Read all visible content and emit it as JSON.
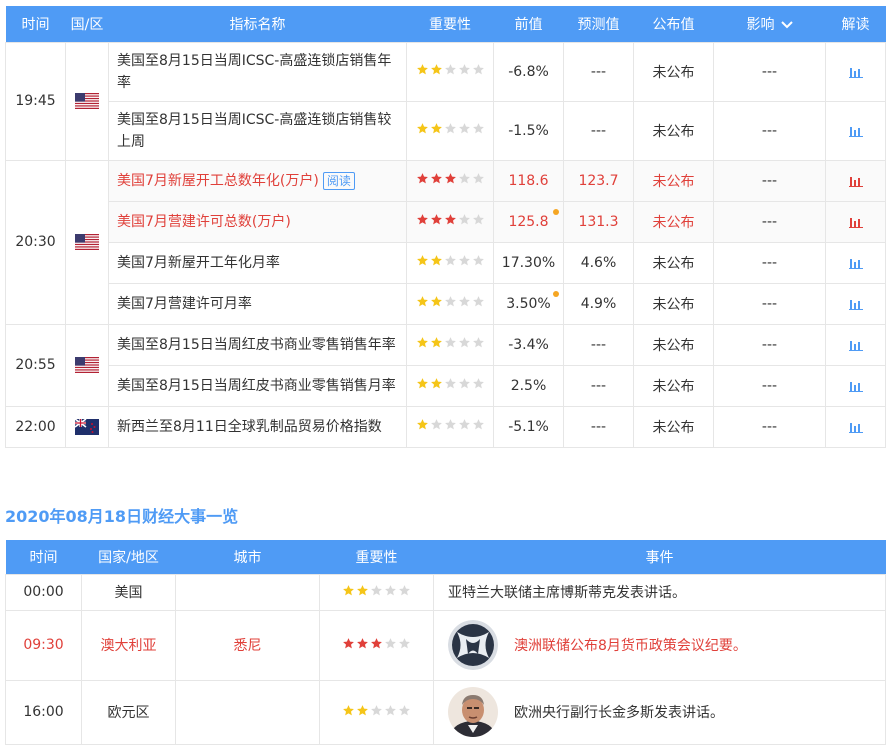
{
  "colors": {
    "header_bg": "#4f9bf5",
    "accent": "#4f9bf5",
    "red": "#e0403a",
    "star_gold": "#f5c518",
    "star_red": "#e0403a",
    "star_empty": "#d8d8d8",
    "dot": "#f5a623"
  },
  "indicators": {
    "headers": {
      "time": "时间",
      "country": "国/区",
      "name": "指标名称",
      "importance": "重要性",
      "prev": "前值",
      "forecast": "预测值",
      "actual": "公布值",
      "impact": "影响",
      "interpret": "解读"
    },
    "groups": [
      {
        "time": "19:45",
        "flag": "flag-us-icon",
        "rows": [
          {
            "name": "美国至8月15日当周ICSC-高盛连锁店销售年率",
            "stars": 2,
            "star_color": "gold",
            "prev": "-6.8%",
            "prev_dot": false,
            "forecast": "---",
            "actual": "未公布",
            "impact": "---",
            "red": false
          },
          {
            "name": "美国至8月15日当周ICSC-高盛连锁店销售较上周",
            "stars": 2,
            "star_color": "gold",
            "prev": "-1.5%",
            "prev_dot": false,
            "forecast": "---",
            "actual": "未公布",
            "impact": "---",
            "red": false
          }
        ]
      },
      {
        "time": "20:30",
        "flag": "flag-us-icon",
        "rows": [
          {
            "name": "美国7月新屋开工总数年化(万户)",
            "tag": "阅读",
            "stars": 3,
            "star_color": "red",
            "prev": "118.6",
            "prev_dot": false,
            "forecast": "123.7",
            "actual": "未公布",
            "impact": "---",
            "red": true
          },
          {
            "name": "美国7月营建许可总数(万户)",
            "stars": 3,
            "star_color": "red",
            "prev": "125.8",
            "prev_dot": true,
            "forecast": "131.3",
            "actual": "未公布",
            "impact": "---",
            "red": true
          },
          {
            "name": "美国7月新屋开工年化月率",
            "stars": 2,
            "star_color": "gold",
            "prev": "17.30%",
            "prev_dot": false,
            "forecast": "4.6%",
            "actual": "未公布",
            "impact": "---",
            "red": false
          },
          {
            "name": "美国7月营建许可月率",
            "stars": 2,
            "star_color": "gold",
            "prev": "3.50%",
            "prev_dot": true,
            "forecast": "4.9%",
            "actual": "未公布",
            "impact": "---",
            "red": false
          }
        ]
      },
      {
        "time": "20:55",
        "flag": "flag-us-icon",
        "rows": [
          {
            "name": "美国至8月15日当周红皮书商业零售销售年率",
            "stars": 2,
            "star_color": "gold",
            "prev": "-3.4%",
            "prev_dot": false,
            "forecast": "---",
            "actual": "未公布",
            "impact": "---",
            "red": false
          },
          {
            "name": "美国至8月15日当周红皮书商业零售销售月率",
            "stars": 2,
            "star_color": "gold",
            "prev": "2.5%",
            "prev_dot": false,
            "forecast": "---",
            "actual": "未公布",
            "impact": "---",
            "red": false
          }
        ]
      },
      {
        "time": "22:00",
        "flag": "flag-nz-icon",
        "rows": [
          {
            "name": "新西兰至8月11日全球乳制品贸易价格指数",
            "stars": 1,
            "star_color": "gold",
            "prev": "-5.1%",
            "prev_dot": false,
            "forecast": "---",
            "actual": "未公布",
            "impact": "---",
            "red": false
          }
        ]
      }
    ]
  },
  "events_section": {
    "title": "2020年08月18日财经大事一览",
    "headers": {
      "time": "时间",
      "country": "国家/地区",
      "city": "城市",
      "importance": "重要性",
      "event": "事件"
    },
    "rows": [
      {
        "time": "00:00",
        "country": "美国",
        "city": "",
        "stars": 2,
        "star_color": "gold",
        "event": "亚特兰大联储主席博斯蒂克发表讲话。",
        "avatar": "",
        "red": false
      },
      {
        "time": "09:30",
        "country": "澳大利亚",
        "city": "悉尼",
        "stars": 3,
        "star_color": "red",
        "event": "澳洲联储公布8月货币政策会议纪要。",
        "avatar": "rba-logo-icon",
        "red": true
      },
      {
        "time": "16:00",
        "country": "欧元区",
        "city": "",
        "stars": 2,
        "star_color": "gold",
        "event": "欧洲央行副行长金多斯发表讲话。",
        "avatar": "speaker-portrait-icon",
        "red": false
      }
    ]
  }
}
